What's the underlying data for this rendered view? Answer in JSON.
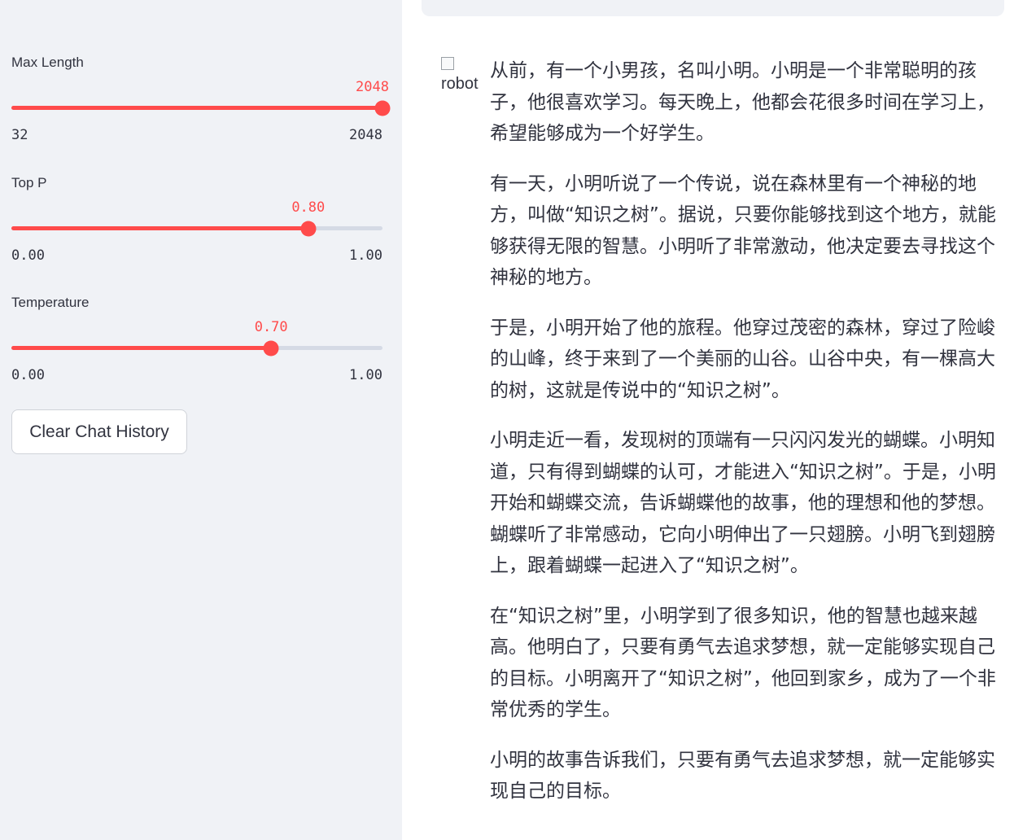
{
  "sidebar": {
    "max_length": {
      "label": "Max Length",
      "value": "2048",
      "min": "32",
      "max": "2048",
      "fraction": 1.0
    },
    "top_p": {
      "label": "Top P",
      "value": "0.80",
      "min": "0.00",
      "max": "1.00",
      "fraction": 0.8
    },
    "temperature": {
      "label": "Temperature",
      "value": "0.70",
      "min": "0.00",
      "max": "1.00",
      "fraction": 0.7
    },
    "clear_button": "Clear Chat History"
  },
  "chat": {
    "avatar_alt": "robot",
    "paragraphs": [
      "从前，有一个小男孩，名叫小明。小明是一个非常聪明的孩子，他很喜欢学习。每天晚上，他都会花很多时间在学习上，希望能够成为一个好学生。",
      "有一天，小明听说了一个传说，说在森林里有一个神秘的地方，叫做“知识之树”。据说，只要你能够找到这个地方，就能够获得无限的智慧。小明听了非常激动，他决定要去寻找这个神秘的地方。",
      "于是，小明开始了他的旅程。他穿过茂密的森林，穿过了险峻的山峰，终于来到了一个美丽的山谷。山谷中央，有一棵高大的树，这就是传说中的“知识之树”。",
      "小明走近一看，发现树的顶端有一只闪闪发光的蝴蝶。小明知道，只有得到蝴蝶的认可，才能进入“知识之树”。于是，小明开始和蝴蝶交流，告诉蝴蝶他的故事，他的理想和他的梦想。蝴蝶听了非常感动，它向小明伸出了一只翅膀。小明飞到翅膀上，跟着蝴蝶一起进入了“知识之树”。",
      "在“知识之树”里，小明学到了很多知识，他的智慧也越来越高。他明白了，只要有勇气去追求梦想，就一定能够实现自己的目标。小明离开了“知识之树”，他回到家乡，成为了一个非常优秀的学生。",
      "小明的故事告诉我们，只要有勇气去追求梦想，就一定能够实现自己的目标。"
    ]
  },
  "colors": {
    "accent": "#ff4b4b",
    "sidebar_bg": "#f0f2f6",
    "text": "#31333f"
  }
}
